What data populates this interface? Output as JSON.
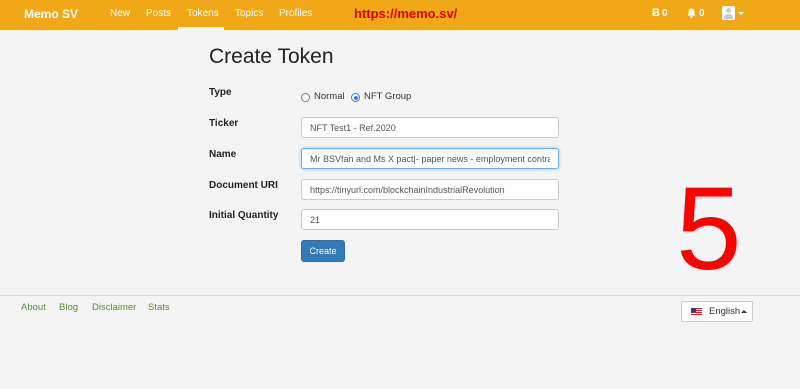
{
  "navbar": {
    "brand": "Memo SV",
    "links": [
      "New",
      "Posts",
      "Tokens",
      "Topics",
      "Profiles"
    ],
    "active_link": "Tokens",
    "overlay_url": "https://memo.sv/",
    "balance": "0",
    "notifications": "0",
    "accent_color": "#f0a817"
  },
  "form": {
    "title": "Create Token",
    "type_label": "Type",
    "type_options": [
      "Normal",
      "NFT Group"
    ],
    "type_selected": "NFT Group",
    "ticker_label": "Ticker",
    "ticker_value": "NFT Test1 - Ref.2020",
    "name_label": "Name",
    "name_value": "Mr BSVfan and Ms X pact|- paper news - employment contrac",
    "doc_uri_label": "Document URI",
    "doc_uri_value": "https://tinyurl.com/blockchainIndustrialRevolution",
    "quantity_label": "Initial Quantity",
    "quantity_value": "21",
    "submit_label": "Create"
  },
  "overlay_step": "5",
  "footer": {
    "links": [
      "About",
      "Blog",
      "Disclaimer",
      "Stats"
    ],
    "language": "English"
  }
}
